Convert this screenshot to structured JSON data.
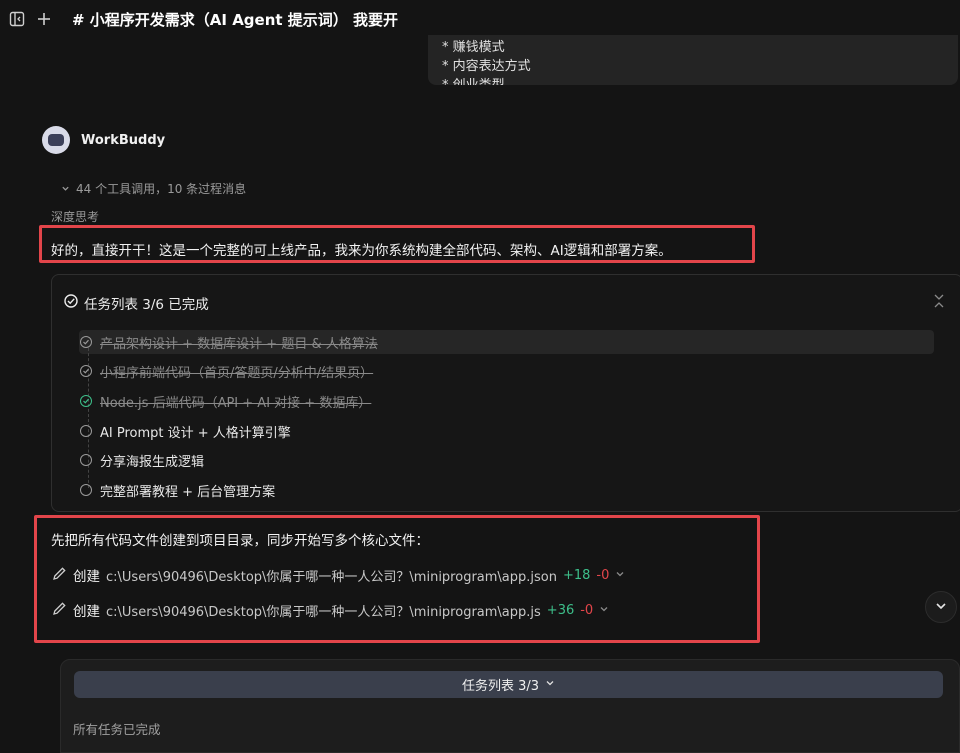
{
  "topbar": {
    "title": "# 小程序开发需求（AI Agent 提示词） 我要开"
  },
  "user_message": {
    "lines": [
      "* 赚钱模式",
      "* 内容表达方式",
      "* 创业类型"
    ]
  },
  "assistant": {
    "name": "WorkBuddy",
    "tool_summary": "44 个工具调用，10 条过程消息",
    "thinking_label": "深度思考",
    "answer": "好的，直接开干！这是一个完整的可上线产品，我来为你系统构建全部代码、架构、AI逻辑和部署方案。"
  },
  "task_list": {
    "title": "任务列表 3/6 已完成",
    "items": [
      {
        "label": "产品架构设计 + 数据库设计 + 题目 & 人格算法",
        "status": "done"
      },
      {
        "label": "小程序前端代码（首页/答题页/分析中/结果页）",
        "status": "done"
      },
      {
        "label": "Node.js 后端代码（API + AI 对接 + 数据库）",
        "status": "done"
      },
      {
        "label": "AI Prompt 设计 + 人格计算引擎",
        "status": "pending"
      },
      {
        "label": "分享海报生成逻辑",
        "status": "pending"
      },
      {
        "label": "完整部署教程 + 后台管理方案",
        "status": "pending"
      }
    ]
  },
  "code": {
    "intro": "先把所有代码文件创建到项目目录，同步开始写多个核心文件：",
    "files": [
      {
        "action": "创建",
        "path": "c:\\Users\\90496\\Desktop\\你属于哪一种一人公司？\\miniprogram\\app.json",
        "added": "+18",
        "removed": "-0"
      },
      {
        "action": "创建",
        "path": "c:\\Users\\90496\\Desktop\\你属于哪一种一人公司？\\miniprogram\\app.js",
        "added": "+36",
        "removed": "-0"
      }
    ]
  },
  "bottom": {
    "task_bar_label": "任务列表 3/3",
    "status": "所有任务已完成"
  },
  "colors": {
    "background": "#141414",
    "highlight_border": "#e2454a",
    "added": "#3dbf8a",
    "removed": "#e2454a",
    "task_bar": "#3a3f4c"
  },
  "icons": [
    "sidebar-toggle-icon",
    "plus-icon",
    "chevron-down-icon",
    "check-circle-icon",
    "collapse-icon",
    "pencil-icon"
  ]
}
